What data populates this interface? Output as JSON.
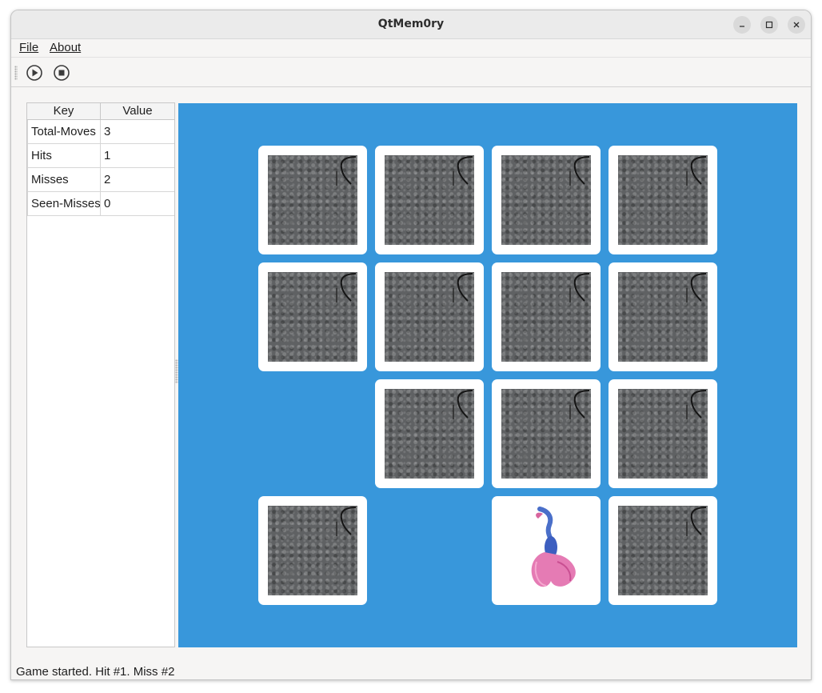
{
  "window": {
    "title": "QtMem0ry"
  },
  "menu": {
    "file": "File",
    "about": "About"
  },
  "toolbar": {
    "play_icon": "play-circle-icon",
    "stop_icon": "stop-circle-icon"
  },
  "stats": {
    "headers": {
      "key": "Key",
      "value": "Value"
    },
    "rows": [
      {
        "key": "Total-Moves",
        "value": "3"
      },
      {
        "key": "Hits",
        "value": "1"
      },
      {
        "key": "Misses",
        "value": "2"
      },
      {
        "key": "Seen-Misses",
        "value": "0"
      }
    ]
  },
  "board": {
    "rows": 4,
    "cols": 4,
    "cells": [
      "hidden",
      "hidden",
      "hidden",
      "hidden",
      "hidden",
      "hidden",
      "hidden",
      "hidden",
      "matched",
      "hidden",
      "hidden",
      "hidden",
      "hidden",
      "matched",
      "revealed",
      "hidden"
    ],
    "revealed_image": "betta-fish",
    "colors": {
      "board_bg": "#3897db",
      "card_back": "#5f6163",
      "card_border": "#ffffff"
    }
  },
  "status": {
    "text": "Game started. Hit #1. Miss #2"
  }
}
